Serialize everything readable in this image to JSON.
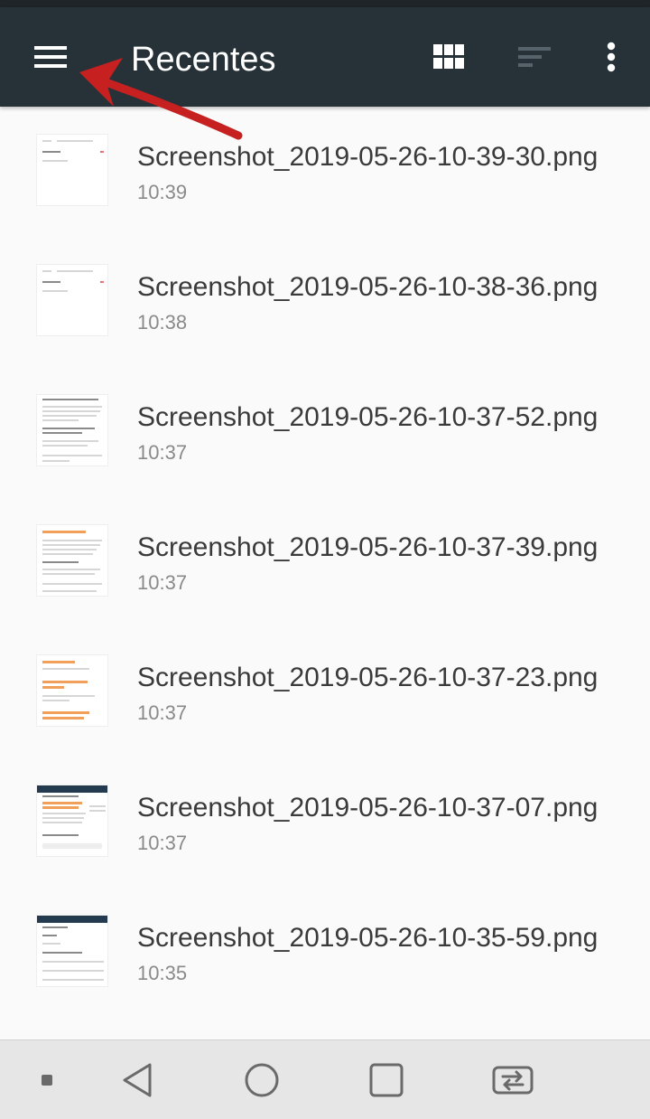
{
  "app_bar": {
    "title": "Recentes",
    "background": "#263238",
    "icons": [
      "menu-icon",
      "grid-view-icon",
      "sort-icon",
      "more-vert-icon"
    ]
  },
  "files": [
    {
      "name": "Screenshot_2019-05-26-10-39-30.png",
      "time": "10:39",
      "thumb": "a"
    },
    {
      "name": "Screenshot_2019-05-26-10-38-36.png",
      "time": "10:38",
      "thumb": "a"
    },
    {
      "name": "Screenshot_2019-05-26-10-37-52.png",
      "time": "10:37",
      "thumb": "b"
    },
    {
      "name": "Screenshot_2019-05-26-10-37-39.png",
      "time": "10:37",
      "thumb": "c"
    },
    {
      "name": "Screenshot_2019-05-26-10-37-23.png",
      "time": "10:37",
      "thumb": "d"
    },
    {
      "name": "Screenshot_2019-05-26-10-37-07.png",
      "time": "10:37",
      "thumb": "e"
    },
    {
      "name": "Screenshot_2019-05-26-10-35-59.png",
      "time": "10:35",
      "thumb": "f"
    }
  ],
  "nav_bar": {
    "icons": [
      "small-square-icon",
      "back-icon",
      "home-icon",
      "recents-icon",
      "switch-apps-icon"
    ]
  },
  "colors": {
    "annotation_arrow": "#c62020",
    "accent_orange": "#f0a05a"
  }
}
